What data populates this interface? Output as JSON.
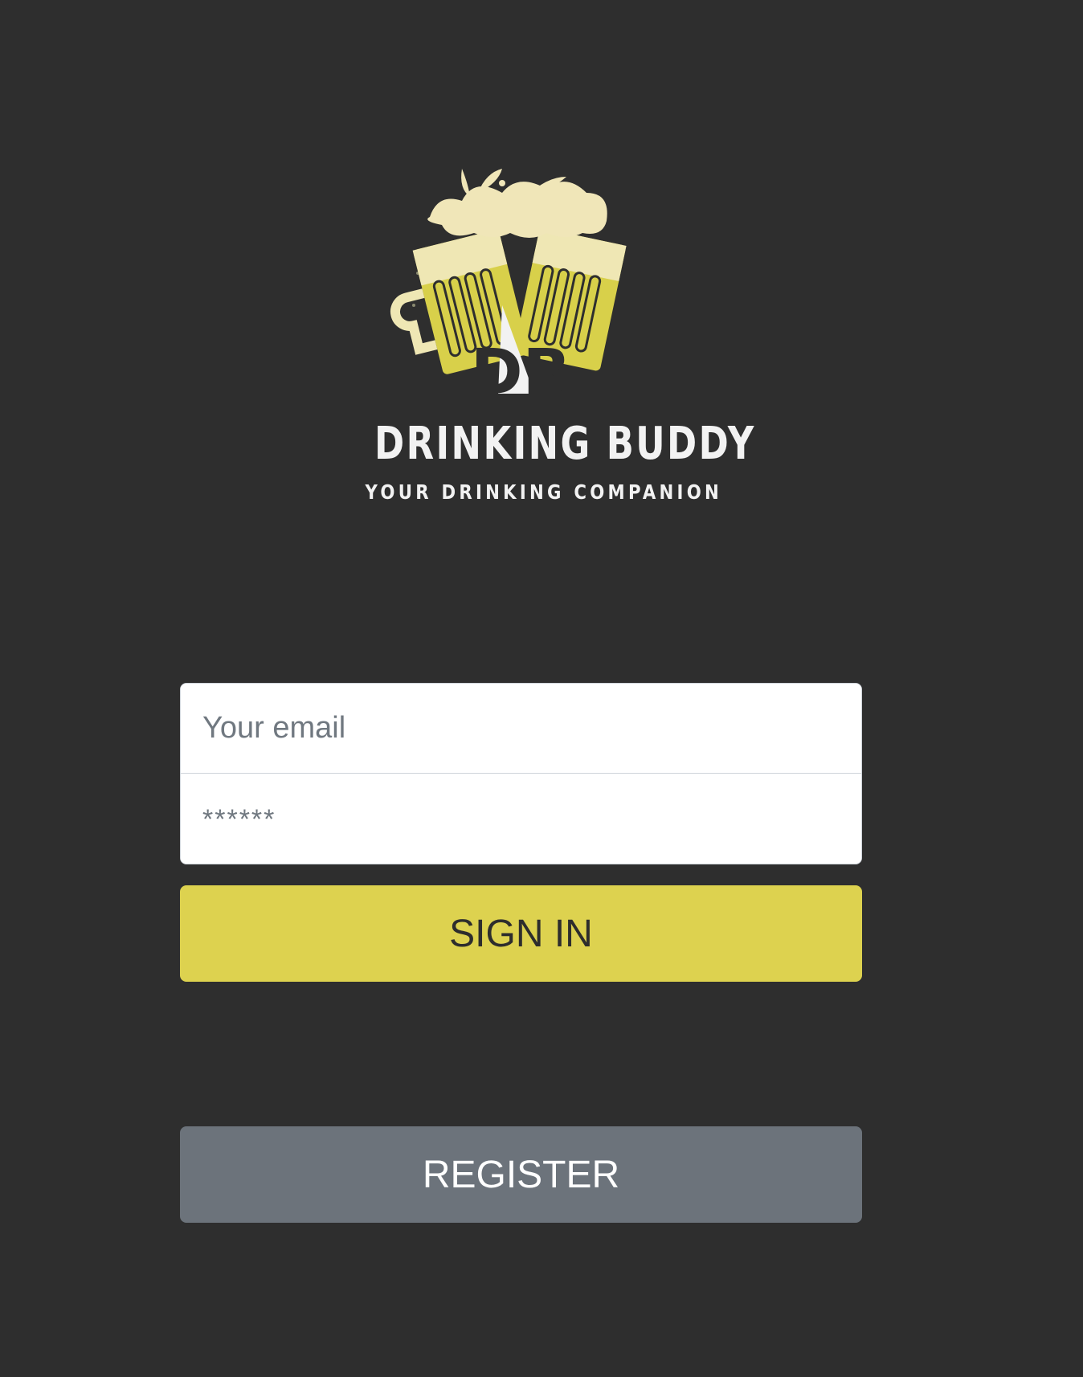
{
  "brand": {
    "name": "DRINKING BUDDY",
    "tagline": "YOUR DRINKING COMPANION",
    "logo_icon": "beer-mugs-cheers-icon",
    "logo_monogram": "DB"
  },
  "form": {
    "email_placeholder": "Your email",
    "password_placeholder": "******",
    "signin_label": "SIGN IN",
    "register_label": "REGISTER"
  },
  "colors": {
    "background": "#2e2e2e",
    "accent": "#ddd24f",
    "secondary_button": "#6c737b",
    "foam": "#f0e6b8",
    "beer": "#d8d04a"
  }
}
